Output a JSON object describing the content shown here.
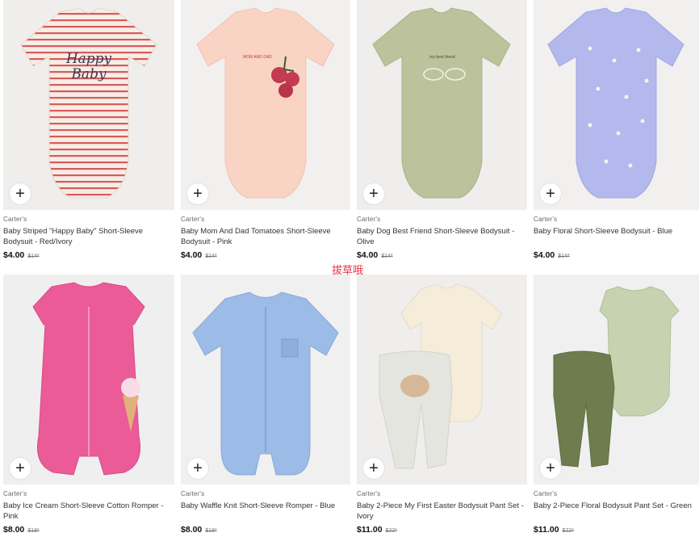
{
  "products": [
    {
      "brand": "Carter's",
      "title": "Baby Striped \"Happy Baby\" Short-Sleeve Bodysuit - Red/Ivory",
      "price": "$4.00",
      "original_price": "$14*",
      "bg": "#efeeec"
    },
    {
      "brand": "Carter's",
      "title": "Baby Mom And Dad Tomatoes Short-Sleeve Bodysuit - Pink",
      "price": "$4.00",
      "original_price": "$14*",
      "bg": "#f1f0ee"
    },
    {
      "brand": "Carter's",
      "title": "Baby Dog Best Friend Short-Sleeve Bodysuit - Olive",
      "price": "$4.00",
      "original_price": "$14*",
      "bg": "#efeeec"
    },
    {
      "brand": "Carter's",
      "title": "Baby Floral Short-Sleeve Bodysuit - Blue",
      "price": "$4.00",
      "original_price": "$14*",
      "bg": "#f1f0ef"
    },
    {
      "brand": "Carter's",
      "title": "Baby Ice Cream Short-Sleeve Cotton Romper - Pink",
      "price": "$8.00",
      "original_price": "$18*",
      "bg": "#efefef"
    },
    {
      "brand": "Carter's",
      "title": "Baby Waffle Knit Short-Sleeve Romper - Blue",
      "price": "$8.00",
      "original_price": "$18*",
      "bg": "#f0f0f0"
    },
    {
      "brand": "Carter's",
      "title": "Baby 2-Piece My First Easter Bodysuit Pant Set - Ivory",
      "price": "$11.00",
      "original_price": "$22*",
      "bg": "#efeeec"
    },
    {
      "brand": "Carter's",
      "title": "Baby 2-Piece Floral Bodysuit Pant Set - Green",
      "price": "$11.00",
      "original_price": "$22*",
      "bg": "#f0f0f0"
    }
  ],
  "add_button_symbol": "+",
  "watermark": "拔草哦",
  "colors": {
    "accent_watermark": "#e8354a",
    "price": "#111111"
  }
}
